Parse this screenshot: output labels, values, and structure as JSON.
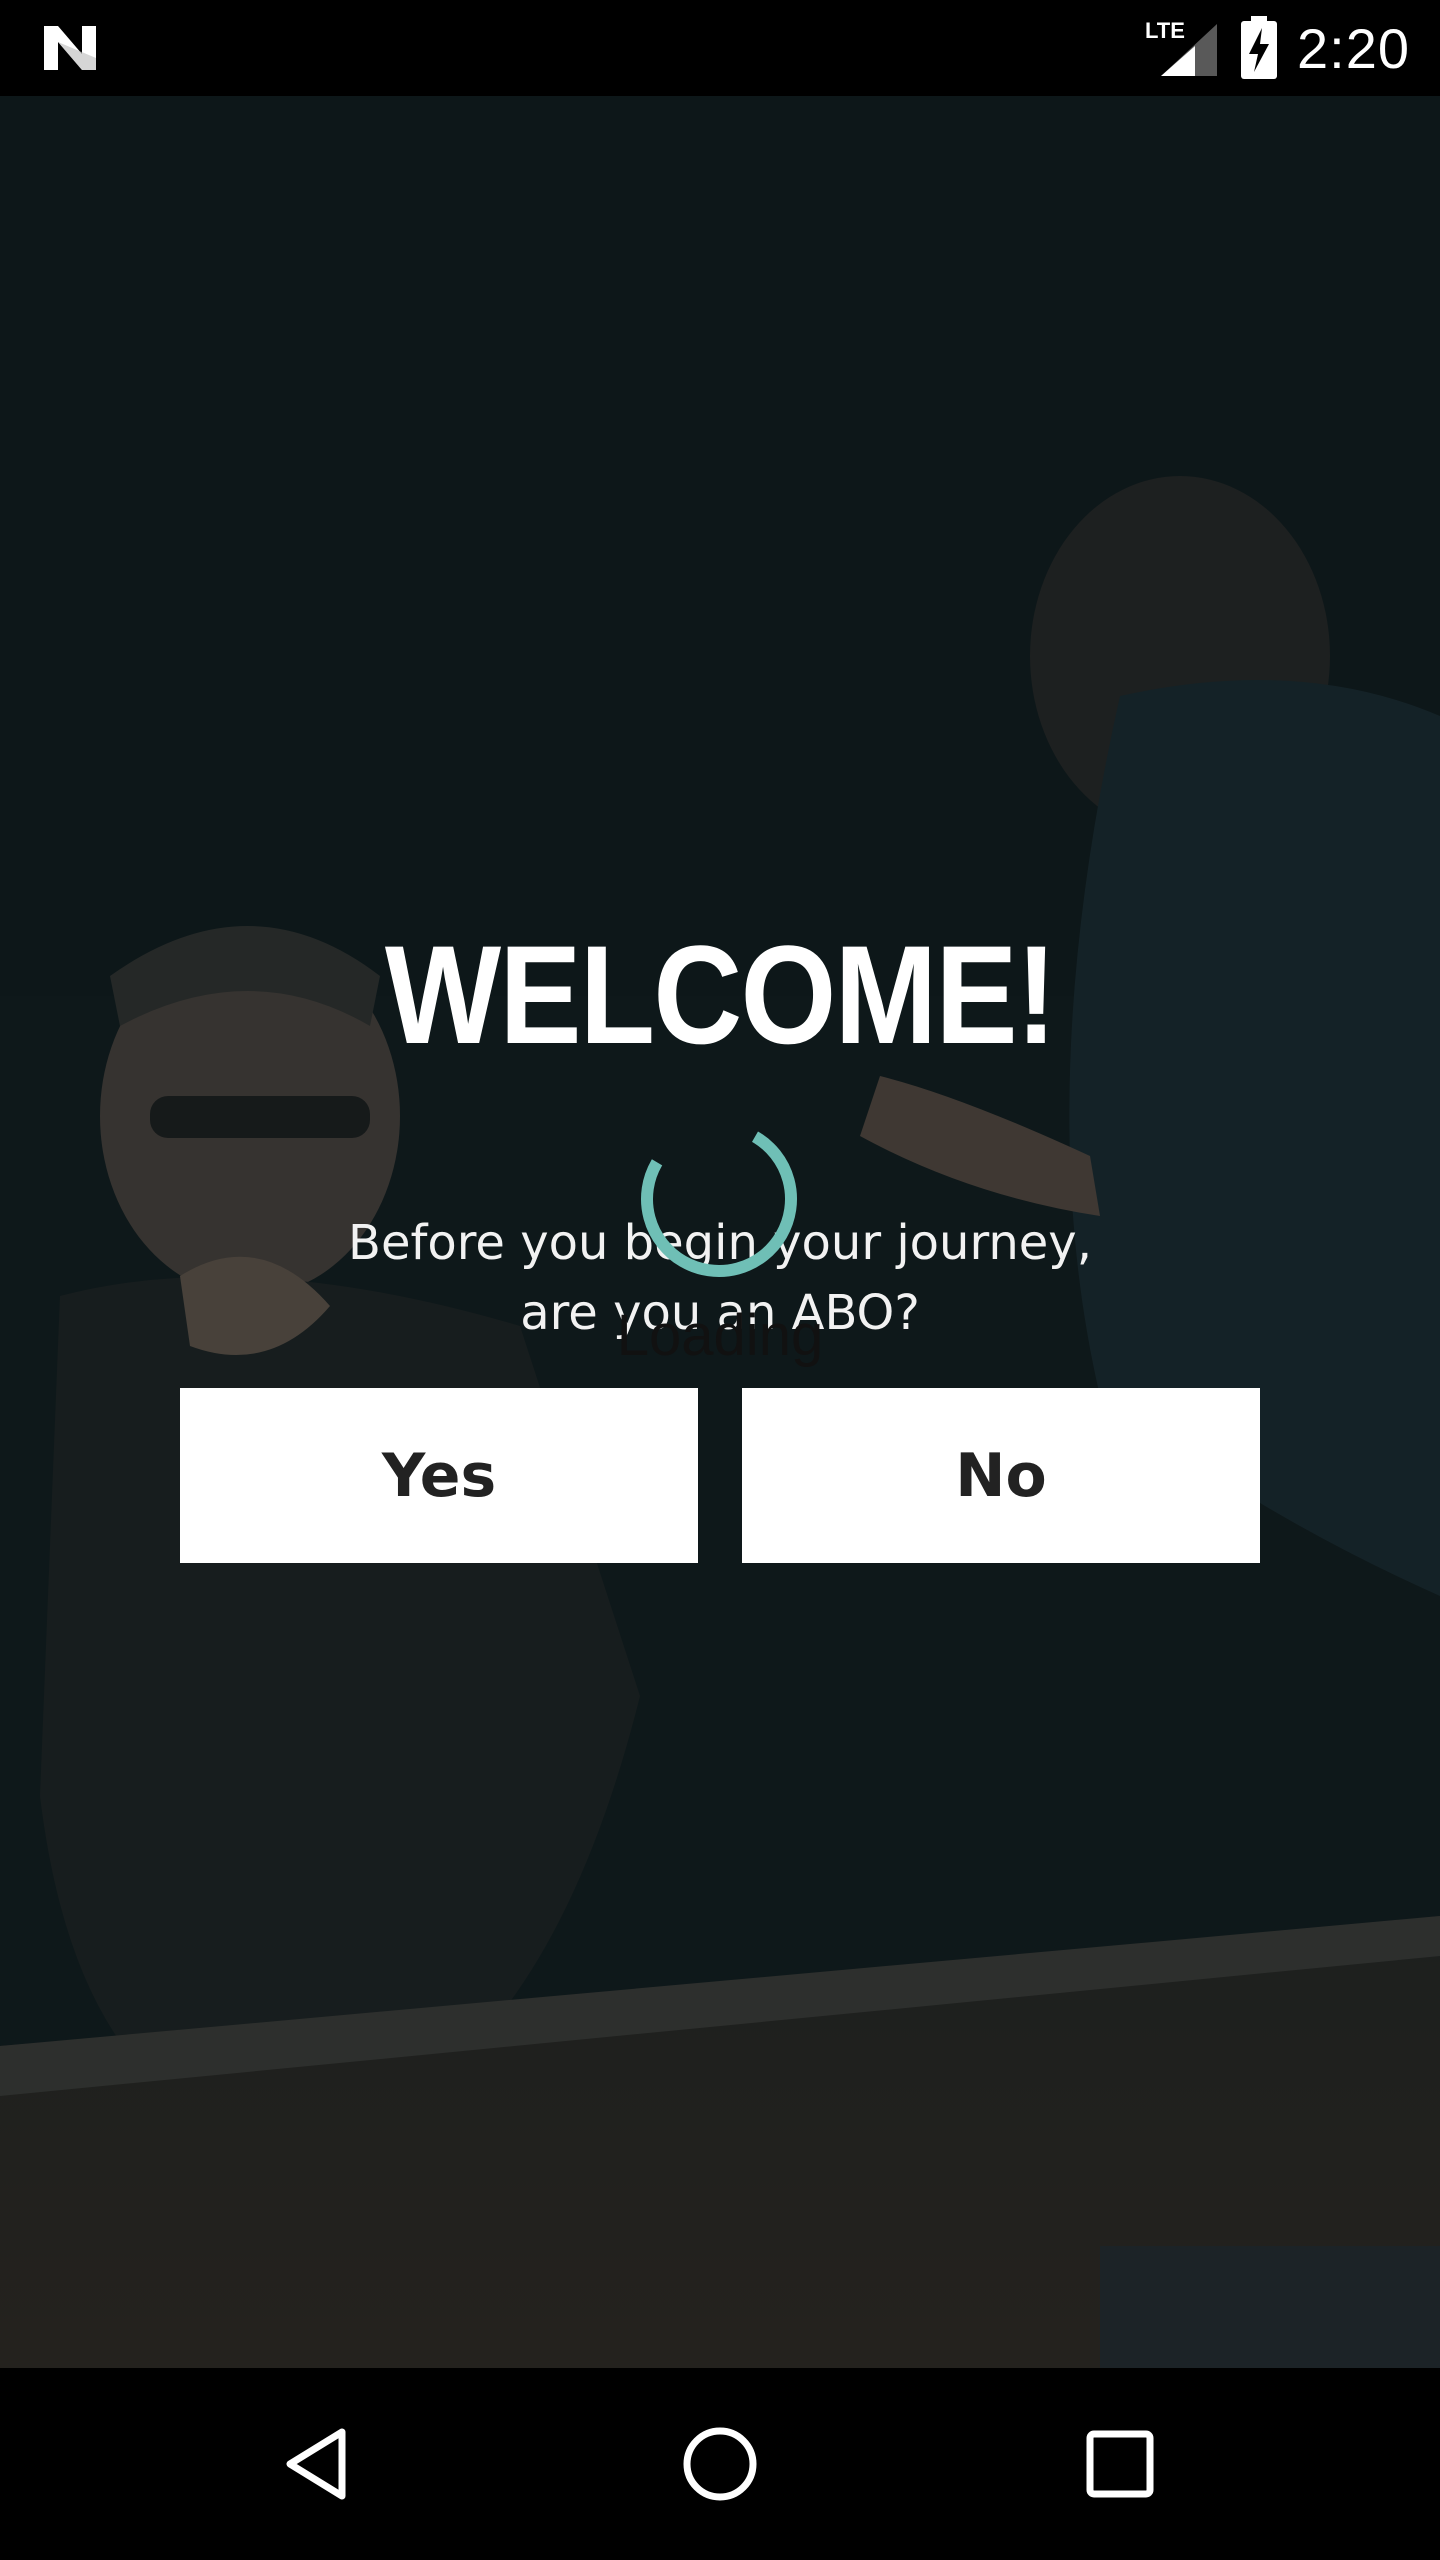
{
  "status_bar": {
    "time": "2:20",
    "network": "LTE",
    "icons": [
      "android-n-icon",
      "lte-signal-icon",
      "battery-charging-icon"
    ]
  },
  "welcome": {
    "title": "WELCOME!",
    "subtitle_line1": "Before you begin your journey,",
    "subtitle_line2": "are you an ABO?"
  },
  "loading": {
    "label": "Loading",
    "spinner_color": "#6fbfb6"
  },
  "buttons": {
    "yes_label": "Yes",
    "no_label": "No"
  },
  "nav_bar": {
    "icons": [
      "back-icon",
      "home-icon",
      "recents-icon"
    ]
  },
  "colors": {
    "background": "#101a1c",
    "button_bg": "#ffffff",
    "button_text": "#222222",
    "accent": "#6fbfb6"
  }
}
